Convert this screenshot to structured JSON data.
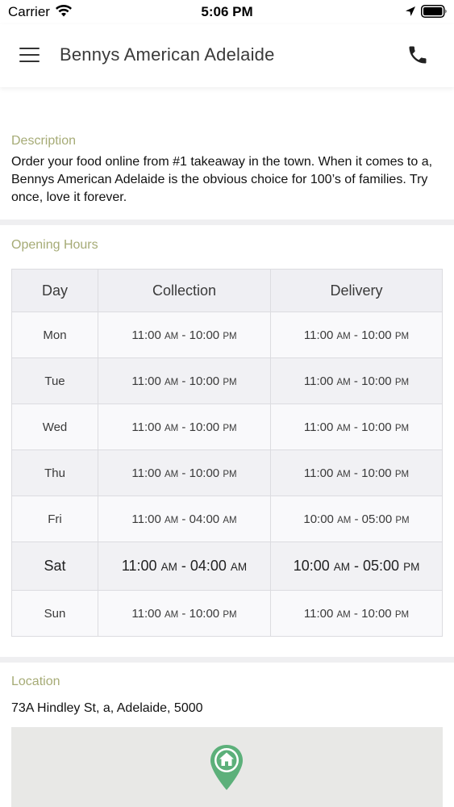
{
  "status_bar": {
    "carrier": "Carrier",
    "time": "5:06 PM",
    "wifi_icon": "wifi-icon",
    "location_icon": "location-arrow-icon",
    "battery_icon": "battery-icon"
  },
  "nav": {
    "title": "Bennys American Adelaide",
    "menu_icon": "hamburger-menu-icon",
    "phone_icon": "phone-icon"
  },
  "description": {
    "label": "Description",
    "text": "Order your food online from #1 takeaway in the town. When it comes to a, Bennys American Adelaide is the obvious choice for 100’s of families. Try once, love it forever."
  },
  "opening_hours": {
    "label": "Opening Hours",
    "headers": [
      "Day",
      "Collection",
      "Delivery"
    ],
    "rows": [
      {
        "day": "Mon",
        "collection": {
          "open": "11:00",
          "open_ap": "AM",
          "close": "10:00",
          "close_ap": "PM"
        },
        "delivery": {
          "open": "11:00",
          "open_ap": "AM",
          "close": "10:00",
          "close_ap": "PM"
        }
      },
      {
        "day": "Tue",
        "collection": {
          "open": "11:00",
          "open_ap": "AM",
          "close": "10:00",
          "close_ap": "PM"
        },
        "delivery": {
          "open": "11:00",
          "open_ap": "AM",
          "close": "10:00",
          "close_ap": "PM"
        }
      },
      {
        "day": "Wed",
        "collection": {
          "open": "11:00",
          "open_ap": "AM",
          "close": "10:00",
          "close_ap": "PM"
        },
        "delivery": {
          "open": "11:00",
          "open_ap": "AM",
          "close": "10:00",
          "close_ap": "PM"
        }
      },
      {
        "day": "Thu",
        "collection": {
          "open": "11:00",
          "open_ap": "AM",
          "close": "10:00",
          "close_ap": "PM"
        },
        "delivery": {
          "open": "11:00",
          "open_ap": "AM",
          "close": "10:00",
          "close_ap": "PM"
        }
      },
      {
        "day": "Fri",
        "collection": {
          "open": "11:00",
          "open_ap": "AM",
          "close": "04:00",
          "close_ap": "AM"
        },
        "delivery": {
          "open": "10:00",
          "open_ap": "AM",
          "close": "05:00",
          "close_ap": "PM"
        }
      },
      {
        "day": "Sat",
        "collection": {
          "open": "11:00",
          "open_ap": "AM",
          "close": "04:00",
          "close_ap": "AM"
        },
        "delivery": {
          "open": "10:00",
          "open_ap": "AM",
          "close": "05:00",
          "close_ap": "PM"
        }
      },
      {
        "day": "Sun",
        "collection": {
          "open": "11:00",
          "open_ap": "AM",
          "close": "10:00",
          "close_ap": "PM"
        },
        "delivery": {
          "open": "11:00",
          "open_ap": "AM",
          "close": "10:00",
          "close_ap": "PM"
        }
      }
    ]
  },
  "location": {
    "label": "Location",
    "address": "73A Hindley St, a, Adelaide, 5000",
    "pin_icon": "map-pin-home-icon"
  },
  "colors": {
    "accent_label": "#a6ab76",
    "pin_green": "#5cb07a"
  }
}
